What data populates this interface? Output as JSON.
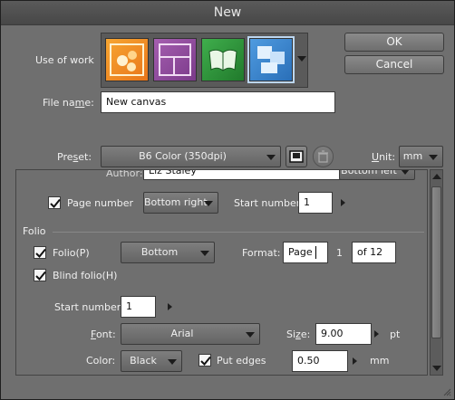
{
  "window": {
    "title": "New"
  },
  "buttons": {
    "ok": "OK",
    "cancel": "Cancel"
  },
  "use_of_work": {
    "label": "Use of work",
    "icons": [
      "illustration-icon",
      "comic-icon",
      "book-icon",
      "animation-icon"
    ],
    "selected_index": 3
  },
  "file_name": {
    "label": "File name:",
    "value": "New canvas"
  },
  "preset": {
    "label": "Preset:",
    "value": "B6 Color (350dpi)"
  },
  "unit": {
    "label": "Unit:",
    "value": "mm"
  },
  "author": {
    "label": "Author:",
    "value": "Liz Staley",
    "position": "Bottom left"
  },
  "page_number": {
    "label": "Page number",
    "checked": true,
    "position": "Bottom right",
    "start_label": "Start number:",
    "start_value": "1"
  },
  "folio": {
    "section_label": "Folio",
    "folio_label": "Folio(P)",
    "folio_checked": true,
    "position": "Bottom",
    "format_label": "Format:",
    "format_prefix": "Page",
    "format_number": "1",
    "format_suffix": "of 12",
    "blind_label": "Blind folio(H)",
    "blind_checked": true,
    "start_label": "Start number:",
    "start_value": "1",
    "font_label": "Font:",
    "font_value": "Arial",
    "size_label": "Size:",
    "size_value": "9.00",
    "size_unit": "pt",
    "color_label": "Color:",
    "color_value": "Black",
    "edges_label": "Put edges",
    "edges_checked": true,
    "edges_value": "0.50",
    "edges_unit": "mm"
  },
  "colors": {
    "window_bg": "#6f6f6f",
    "selected_outline": "#bcd6f0"
  }
}
